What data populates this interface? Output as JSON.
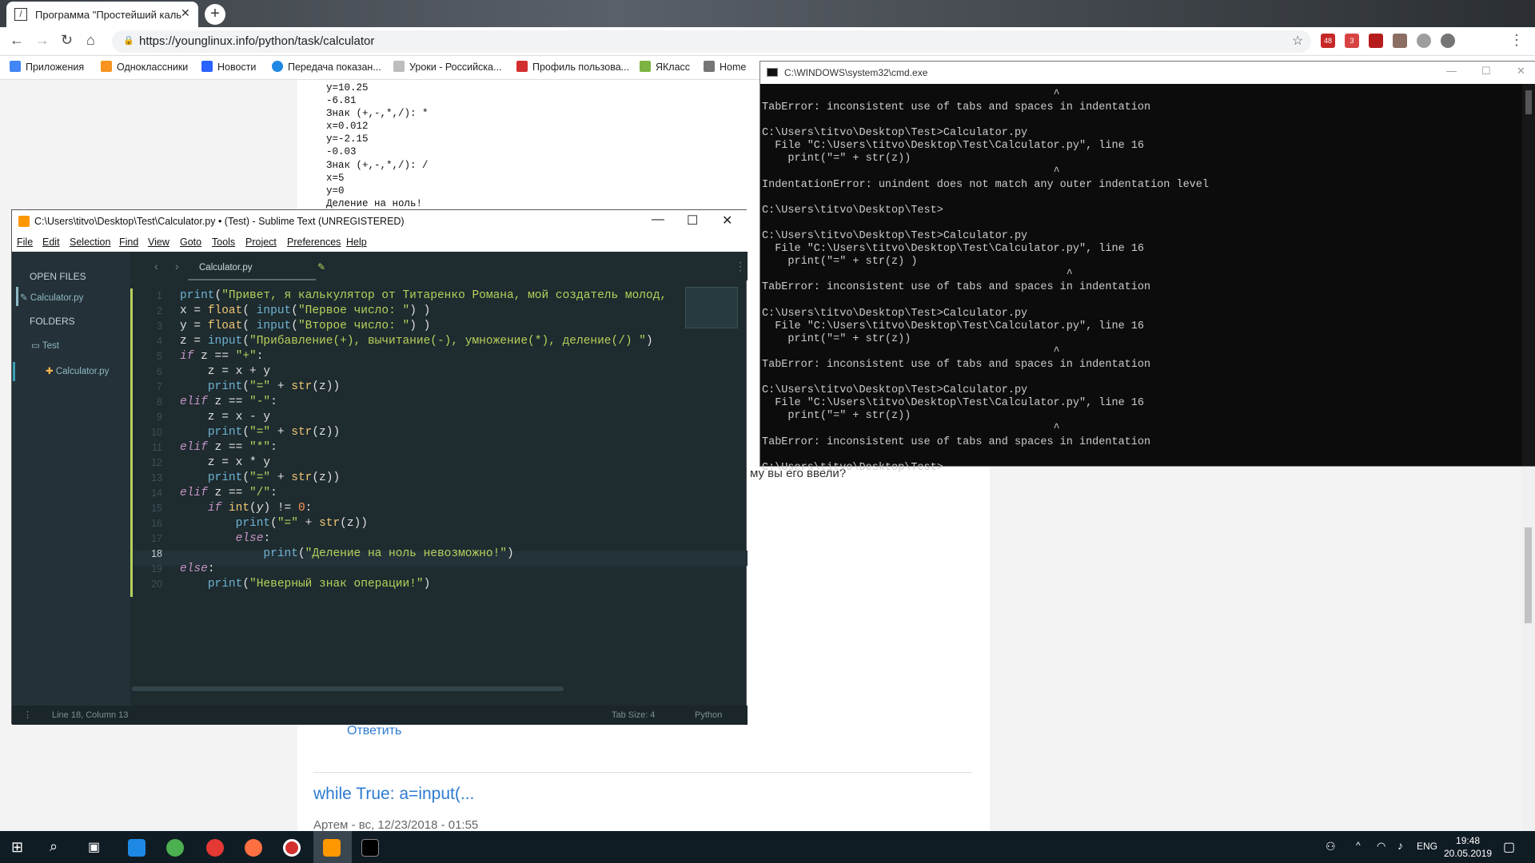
{
  "browser": {
    "tab_title": "Программа \"Простейший каль",
    "url": "https://younglinux.info/python/task/calculator",
    "bookmarks": [
      "Приложения",
      "Одноклассники",
      "Новости",
      "Передача показан...",
      "Уроки - Российска...",
      "Профиль пользова...",
      "ЯКласс",
      "Home"
    ],
    "badge_mail": "48",
    "badge_ext": "3"
  },
  "page": {
    "output_lines": [
      "y=10.25",
      "-6.81",
      "Знак (+,-,*,/): *",
      "x=0.012",
      "y=-2.15",
      "-0.03",
      "Знак (+,-,*,/): /",
      "x=5",
      "y=0",
      "Деление на ноль!"
    ],
    "ask_text": "му вы его ввели?",
    "reply_link": "Ответить",
    "comment_title": "while True: a=input(...",
    "comment_meta": "Артем - вс, 12/23/2018 - 01:55"
  },
  "sublime": {
    "title": "C:\\Users\\titvo\\Desktop\\Test\\Calculator.py • (Test) - Sublime Text (UNREGISTERED)",
    "menu": [
      "File",
      "Edit",
      "Selection",
      "Find",
      "View",
      "Goto",
      "Tools",
      "Project",
      "Preferences",
      "Help"
    ],
    "open_files_label": "OPEN FILES",
    "open_file": "Calculator.py",
    "folders_label": "FOLDERS",
    "folder": "Test",
    "folder_file": "Calculator.py",
    "tab_label": "Calculator.py",
    "line_numbers": [
      "1",
      "2",
      "3",
      "4",
      "5",
      "6",
      "7",
      "8",
      "9",
      "10",
      "11",
      "12",
      "13",
      "14",
      "15",
      "16",
      "17",
      "18",
      "19",
      "20"
    ],
    "status_left": "Line 18, Column 13",
    "status_tab": "Tab Size: 4",
    "status_lang": "Python"
  },
  "cmd": {
    "title": "C:\\WINDOWS\\system32\\cmd.exe",
    "text": "                                             ^\nTabError: inconsistent use of tabs and spaces in indentation\n\nC:\\Users\\titvo\\Desktop\\Test>Calculator.py\n  File \"C:\\Users\\titvo\\Desktop\\Test\\Calculator.py\", line 16\n    print(\"=\" + str(z))\n                                             ^\nIndentationError: unindent does not match any outer indentation level\n\nC:\\Users\\titvo\\Desktop\\Test>\n\nC:\\Users\\titvo\\Desktop\\Test>Calculator.py\n  File \"C:\\Users\\titvo\\Desktop\\Test\\Calculator.py\", line 16\n    print(\"=\" + str(z) )\n                                               ^\nTabError: inconsistent use of tabs and spaces in indentation\n\nC:\\Users\\titvo\\Desktop\\Test>Calculator.py\n  File \"C:\\Users\\titvo\\Desktop\\Test\\Calculator.py\", line 16\n    print(\"=\" + str(z))\n                                             ^\nTabError: inconsistent use of tabs and spaces in indentation\n\nC:\\Users\\titvo\\Desktop\\Test>Calculator.py\n  File \"C:\\Users\\titvo\\Desktop\\Test\\Calculator.py\", line 16\n    print(\"=\" + str(z))\n                                             ^\nTabError: inconsistent use of tabs and spaces in indentation\n\nC:\\Users\\titvo\\Desktop\\Test>"
  },
  "taskbar": {
    "lang": "ENG",
    "time": "19:48",
    "date": "20.05.2019"
  }
}
